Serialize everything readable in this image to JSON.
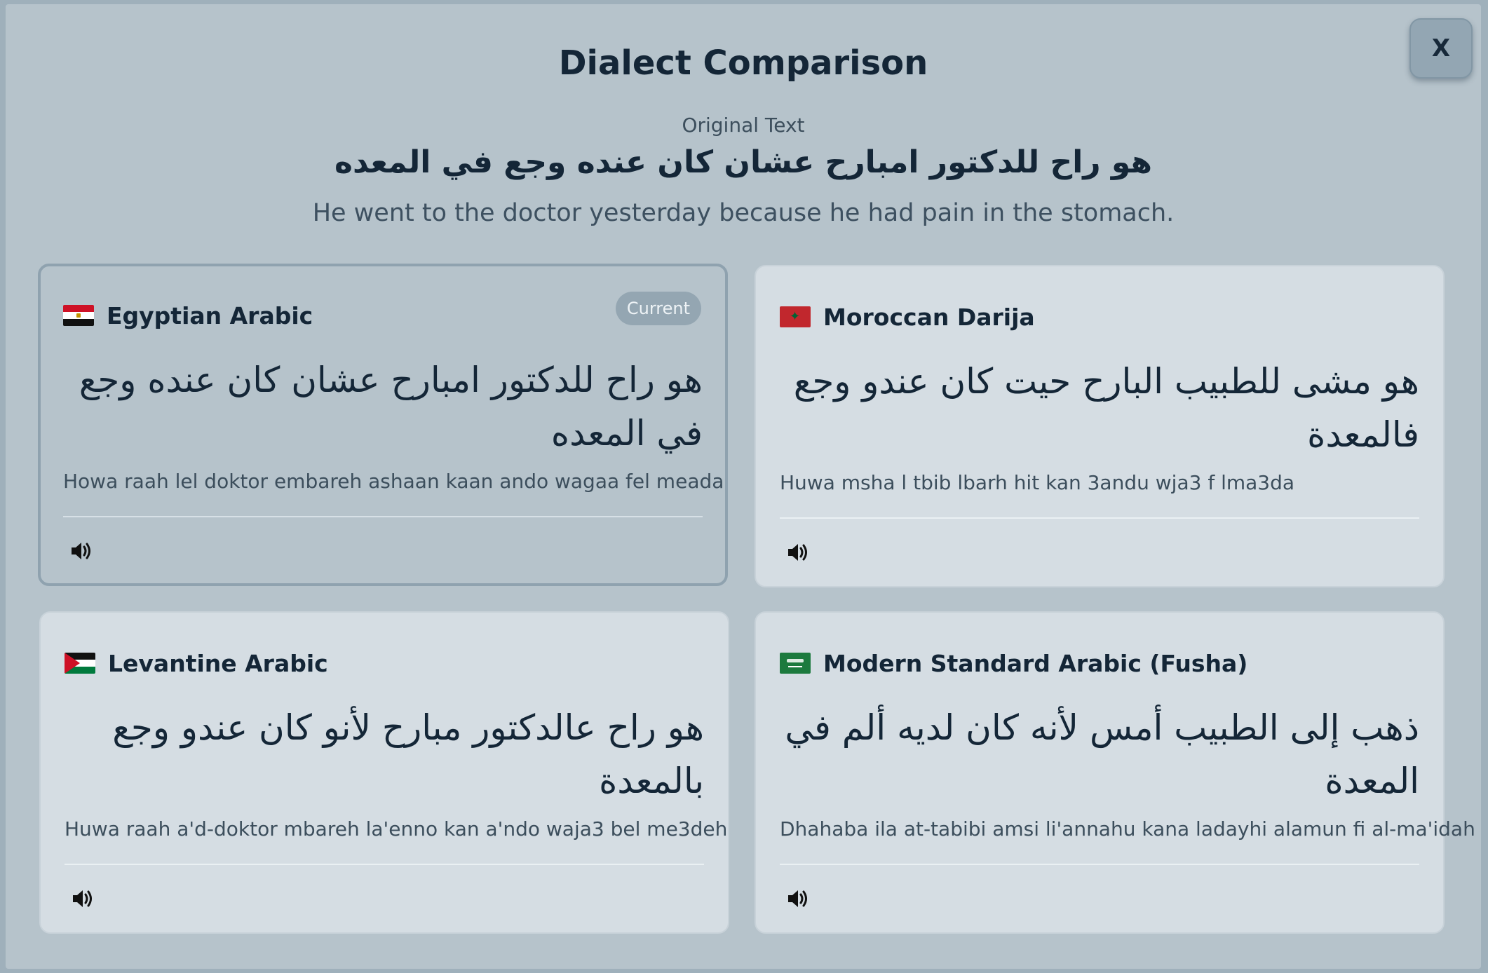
{
  "modal": {
    "title": "Dialect Comparison",
    "close_label": "X",
    "original_label": "Original Text",
    "original_arabic": "هو راح للدكتور امبارح عشان كان عنده وجع في المعده",
    "original_english": "He went to the doctor yesterday because he had pain in the stomach."
  },
  "cards": [
    {
      "name": "Egyptian Arabic",
      "flag": "egypt-flag",
      "badge": "Current",
      "arabic": "هو راح للدكتور امبارح عشان كان عنده وجع في المعده",
      "translit": "Howa raah lel doktor embareh ashaan kaan ando wagaa fel meada",
      "audio_icon": "speaker-icon"
    },
    {
      "name": "Moroccan Darija",
      "flag": "morocco-flag",
      "arabic": "هو مشى للطبيب البارح حيت كان عندو وجع فالمعدة",
      "translit": "Huwa msha l tbib lbarh hit kan 3andu wja3 f lma3da",
      "audio_icon": "speaker-icon"
    },
    {
      "name": "Levantine Arabic",
      "flag": "jordan-flag",
      "arabic": "هو راح عالدكتور مبارح لأنو كان عندو وجع بالمعدة",
      "translit": "Huwa raah a'd-doktor mbareh la'enno kan a'ndo waja3 bel me3deh",
      "audio_icon": "speaker-icon"
    },
    {
      "name": "Modern Standard Arabic (Fusha)",
      "flag": "saudi-flag",
      "arabic": "ذهب إلى الطبيب أمس لأنه كان لديه ألم في المعدة",
      "translit": "Dhahaba ila at-tabibi amsi li'annahu kana ladayhi alamun fi al-ma'idah",
      "audio_icon": "speaker-icon"
    }
  ],
  "colors": {
    "backdrop": "#9fb0bb",
    "modal": "#b6c3cb",
    "card": "#d5dde3",
    "current_card": "#b6c3cb",
    "text_dark": "#142637",
    "badge": "#94a6b2"
  }
}
